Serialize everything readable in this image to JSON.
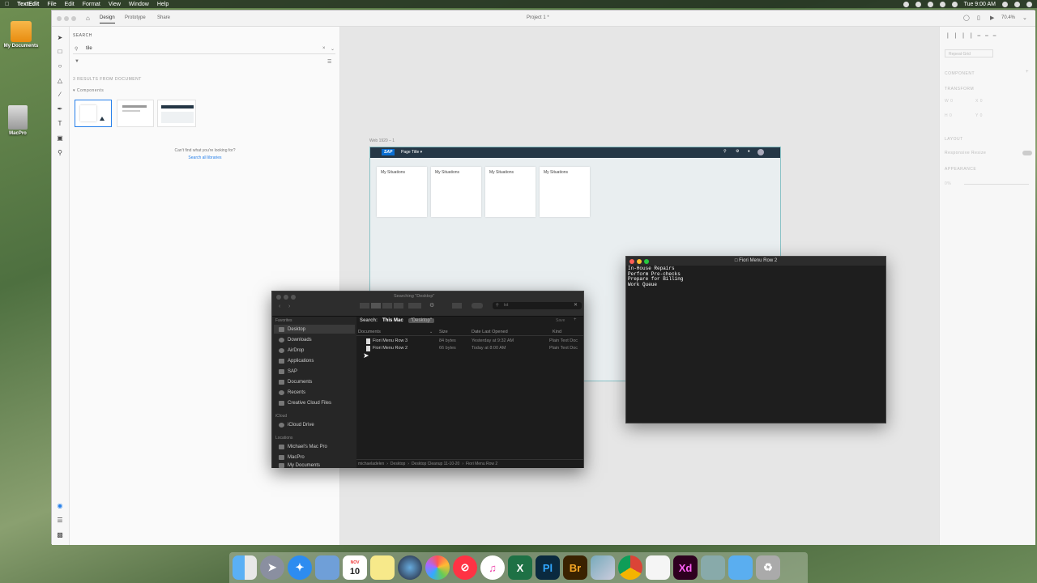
{
  "menubar": {
    "app_name": "TextEdit",
    "menus": [
      "File",
      "Edit",
      "Format",
      "View",
      "Window",
      "Help"
    ],
    "clock": "Tue 9:00 AM"
  },
  "desktop": {
    "icons": [
      {
        "label": "My Documents"
      },
      {
        "label": "MacPro"
      }
    ]
  },
  "xd": {
    "tabs": [
      "Design",
      "Prototype",
      "Share"
    ],
    "project_title": "Project 1 *",
    "zoom": "70.4%",
    "panel": {
      "heading": "SEARCH",
      "search_value": "tile",
      "results_label": "3 RESULTS FROM DOCUMENT",
      "group_label": "Components",
      "not_found": "Can't find what you're looking for?",
      "search_all": "Search all libraries"
    },
    "artboard": {
      "name": "Web 1920 – 1",
      "logo": "SAP",
      "page_title": "Page Title",
      "tiles": [
        "My Situations",
        "My Situations",
        "My Situations",
        "My Situations"
      ]
    },
    "props": {
      "repeat_grid": "Repeat Grid",
      "component": "COMPONENT",
      "transform": "TRANSFORM",
      "w": "W",
      "h": "H",
      "x": "X",
      "y": "Y",
      "w_val": "0",
      "h_val": "0",
      "x_val": "0",
      "y_val": "0",
      "layout": "LAYOUT",
      "responsive": "Responsive Resize",
      "appearance": "APPEARANCE",
      "opacity": "0%"
    }
  },
  "textedit": {
    "title": "Fiori Menu Row 2",
    "body": "In-House Repairs\nPerform Pre-checks\nPrepare for Billing\nWork Queue"
  },
  "finder": {
    "title": "Searching \"Desktop\"",
    "search_field": "txt",
    "search_label": "Search:",
    "scope_this_mac": "This Mac",
    "scope_desktop": "\"Desktop\"",
    "save": "Save",
    "sidebar": {
      "favorites_head": "Favorites",
      "favorites": [
        "Desktop",
        "Downloads",
        "AirDrop",
        "Applications",
        "SAP",
        "Documents",
        "Recents",
        "Creative Cloud Files"
      ],
      "icloud_head": "iCloud",
      "icloud": [
        "iCloud Drive"
      ],
      "locations_head": "Locations",
      "locations": [
        "Michael's Mac Pro",
        "MacPro",
        "My Documents"
      ]
    },
    "columns": [
      "Documents",
      "Size",
      "Date Last Opened",
      "Kind"
    ],
    "files": [
      {
        "name": "Fiori Menu Row 3",
        "size": "84 bytes",
        "date": "Yesterday at 9:32 AM",
        "kind": "Plain Text Doc"
      },
      {
        "name": "Fiori Menu Row 2",
        "size": "66 bytes",
        "date": "Today at 8:00 AM",
        "kind": "Plain Text Doc"
      }
    ],
    "path": [
      "michaeladelen",
      "Desktop",
      "Desktop Cleanup 11-10-20",
      "Fiori Menu Row 2"
    ]
  },
  "dock": {
    "apps": [
      "Finder",
      "Launchpad",
      "Safari",
      "Preview",
      "Calendar",
      "Notes",
      "Siri",
      "Photos",
      "News",
      "iTunes",
      "Excel",
      "Photoshop",
      "Bridge",
      "Xcode",
      "Chrome",
      "TextEdit",
      "Adobe XD",
      "Files",
      "Folder",
      "Trash"
    ],
    "calendar_month": "NOV",
    "calendar_day": "10",
    "excel": "X",
    "photoshop": "Pl",
    "bridge": "Br",
    "xd": "Xd"
  },
  "colors": {
    "shellbar": "#253746",
    "finder_bg": "#1f1f1f",
    "textedit_bg": "#1e1e1e",
    "xd_accent": "#ff61f6"
  }
}
